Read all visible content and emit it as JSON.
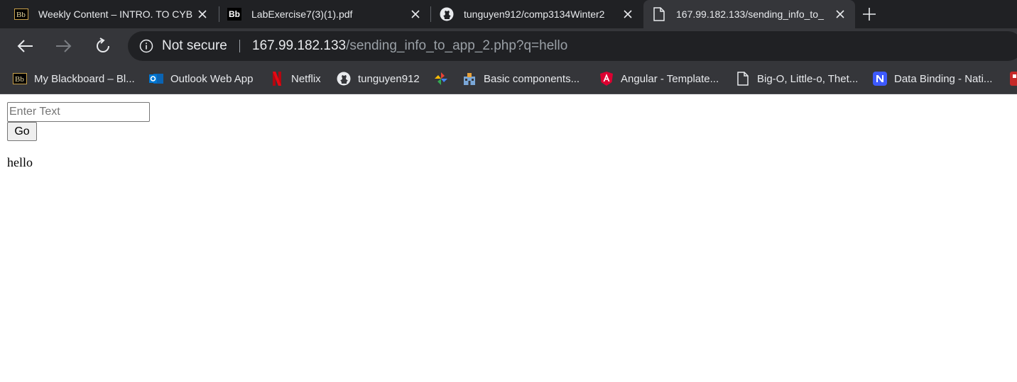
{
  "tabs": [
    {
      "title": "Weekly Content – INTRO. TO CYB",
      "favicon": "blackboard-icon",
      "active": false
    },
    {
      "title": "LabExercise7(3)(1).pdf",
      "favicon": "blackboard-icon",
      "active": false
    },
    {
      "title": "tunguyen912/comp3134Winter2",
      "favicon": "github-icon",
      "active": false
    },
    {
      "title": "167.99.182.133/sending_info_to_",
      "favicon": "page-icon",
      "active": true
    }
  ],
  "toolbar": {
    "security_label": "Not secure",
    "url_host": "167.99.182.133",
    "url_path": "/sending_info_to_app_2.php?q=hello"
  },
  "bookmarks": [
    {
      "label": "My Blackboard – Bl...",
      "icon": "blackboard-icon"
    },
    {
      "label": "Outlook Web App",
      "icon": "outlook-icon"
    },
    {
      "label": "Netflix",
      "icon": "netflix-icon"
    },
    {
      "label": "tunguyen912",
      "icon": "github-icon"
    },
    {
      "label": "",
      "icon": "pinwheel-icon"
    },
    {
      "label": "Basic components...",
      "icon": "building-icon"
    },
    {
      "label": "Angular - Template...",
      "icon": "angular-icon"
    },
    {
      "label": "Big-O, Little-o, Thet...",
      "icon": "page-icon"
    },
    {
      "label": "Data Binding - Nati...",
      "icon": "nativescript-icon"
    }
  ],
  "page": {
    "input_placeholder": "Enter Text",
    "input_value": "",
    "go_label": "Go",
    "result_text": "hello"
  },
  "colors": {
    "tabstrip_bg": "#202124",
    "toolbar_bg": "#35363a",
    "omnibox_bg": "#202124",
    "text_light": "#e8eaed",
    "text_muted": "#9aa0a6"
  }
}
